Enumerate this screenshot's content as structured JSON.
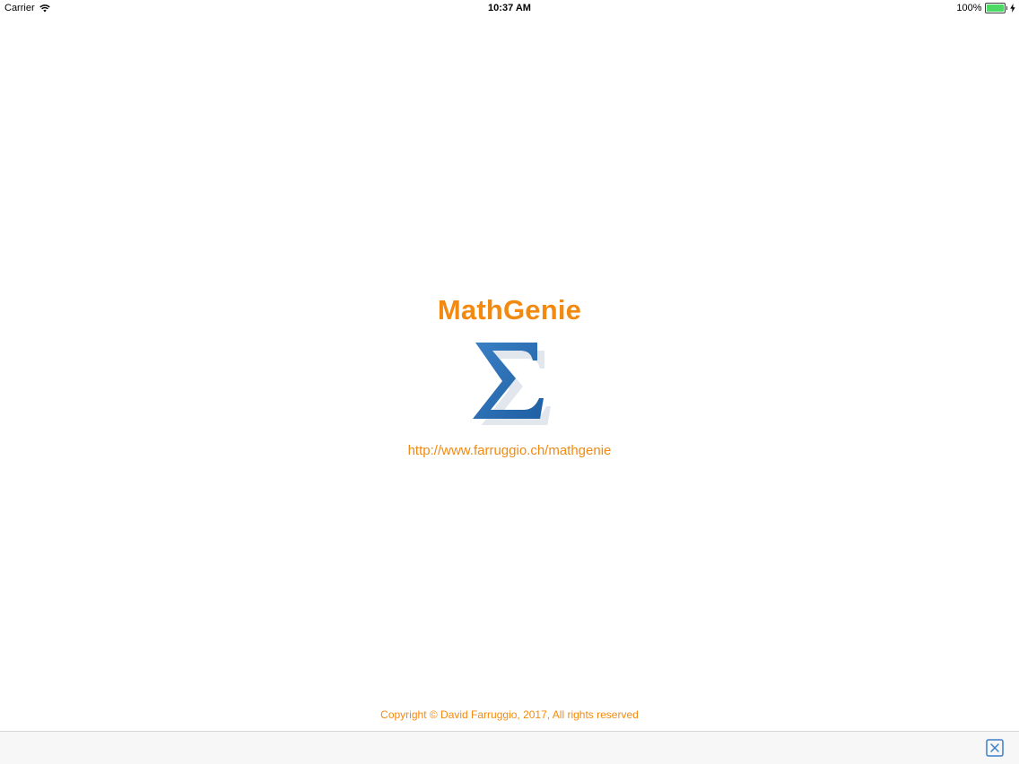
{
  "status_bar": {
    "carrier": "Carrier",
    "time": "10:37 AM",
    "battery_percent": "100%",
    "battery_level": 1.0,
    "wifi_icon": "wifi-icon",
    "charging_icon": "bolt-icon"
  },
  "app": {
    "title": "MathGenie",
    "logo_icon": "sigma-icon",
    "url": "http://www.farruggio.ch/mathgenie",
    "copyright": "Copyright © David Farruggio, 2017, All rights reserved"
  },
  "bottom_bar": {
    "close_icon": "close-icon"
  },
  "colors": {
    "accent": "#f28a12",
    "logo_blue": "#2a6db0",
    "battery_green": "#4cd964"
  }
}
